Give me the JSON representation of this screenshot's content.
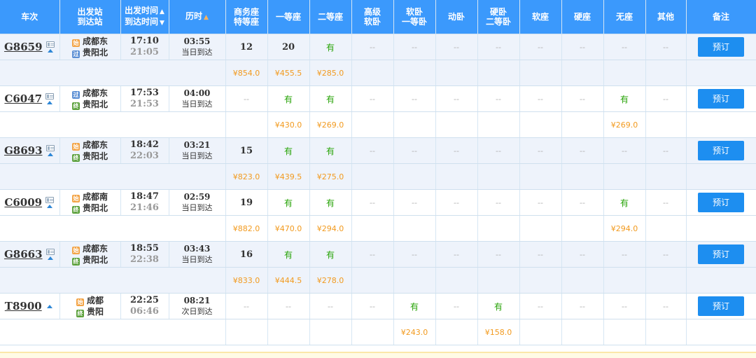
{
  "headers": {
    "train": "车次",
    "station_a": "出发站",
    "station_b": "到达站",
    "time_a": "出发时间",
    "time_b": "到达时间",
    "duration": "历时",
    "business_a": "商务座",
    "business_b": "特等座",
    "first": "一等座",
    "second": "二等座",
    "highsoft_a": "高级",
    "highsoft_b": "软卧",
    "soft_a": "软卧",
    "soft_b": "一等卧",
    "dongwo": "动卧",
    "hard_a": "硬卧",
    "hard_b": "二等卧",
    "softseat": "软座",
    "hardseat": "硬座",
    "noseat": "无座",
    "other": "其他",
    "remark": "备注"
  },
  "icons": {
    "sort_up": "caret-up",
    "sort_down": "caret-down",
    "train_info": "id-card-icon",
    "expand": "triangle-up-icon"
  },
  "colors": {
    "header_bg": "#3b99fc",
    "button_bg": "#1d8ef0",
    "available": "#26a306",
    "price": "#f29a1e"
  },
  "trains": [
    {
      "no": "G8659",
      "from_badge": "始",
      "from": "成都东",
      "to_badge": "过",
      "to": "贵阳北",
      "dep": "17:10",
      "arr": "21:05",
      "dur": "03:55",
      "dur_note": "当日到达",
      "seats": [
        "12",
        "20",
        "有",
        "--",
        "--",
        "--",
        "--",
        "--",
        "--",
        "--",
        "--"
      ],
      "prices": [
        "¥854.0",
        "¥455.5",
        "¥285.0",
        "",
        "",
        "",
        "",
        "",
        "",
        "",
        ""
      ],
      "book": "预订"
    },
    {
      "no": "C6047",
      "from_badge": "过",
      "from": "成都东",
      "to_badge": "终",
      "to": "贵阳北",
      "dep": "17:53",
      "arr": "21:53",
      "dur": "04:00",
      "dur_note": "当日到达",
      "seats": [
        "--",
        "有",
        "有",
        "--",
        "--",
        "--",
        "--",
        "--",
        "--",
        "有",
        "--"
      ],
      "prices": [
        "",
        "¥430.0",
        "¥269.0",
        "",
        "",
        "",
        "",
        "",
        "",
        "¥269.0",
        ""
      ],
      "book": "预订"
    },
    {
      "no": "G8693",
      "from_badge": "始",
      "from": "成都东",
      "to_badge": "终",
      "to": "贵阳北",
      "dep": "18:42",
      "arr": "22:03",
      "dur": "03:21",
      "dur_note": "当日到达",
      "seats": [
        "15",
        "有",
        "有",
        "--",
        "--",
        "--",
        "--",
        "--",
        "--",
        "--",
        "--"
      ],
      "prices": [
        "¥823.0",
        "¥439.5",
        "¥275.0",
        "",
        "",
        "",
        "",
        "",
        "",
        "",
        ""
      ],
      "book": "预订"
    },
    {
      "no": "C6009",
      "from_badge": "始",
      "from": "成都南",
      "to_badge": "终",
      "to": "贵阳北",
      "dep": "18:47",
      "arr": "21:46",
      "dur": "02:59",
      "dur_note": "当日到达",
      "seats": [
        "19",
        "有",
        "有",
        "--",
        "--",
        "--",
        "--",
        "--",
        "--",
        "有",
        "--"
      ],
      "prices": [
        "¥882.0",
        "¥470.0",
        "¥294.0",
        "",
        "",
        "",
        "",
        "",
        "",
        "¥294.0",
        ""
      ],
      "book": "预订"
    },
    {
      "no": "G8663",
      "from_badge": "始",
      "from": "成都东",
      "to_badge": "终",
      "to": "贵阳北",
      "dep": "18:55",
      "arr": "22:38",
      "dur": "03:43",
      "dur_note": "当日到达",
      "seats": [
        "16",
        "有",
        "有",
        "--",
        "--",
        "--",
        "--",
        "--",
        "--",
        "--",
        "--"
      ],
      "prices": [
        "¥833.0",
        "¥444.5",
        "¥278.0",
        "",
        "",
        "",
        "",
        "",
        "",
        "",
        ""
      ],
      "book": "预订"
    },
    {
      "no": "T8900",
      "from_badge": "始",
      "from": "成都",
      "to_badge": "终",
      "to": "贵阳",
      "dep": "22:25",
      "arr": "06:46",
      "dur": "08:21",
      "dur_note": "次日到达",
      "seats": [
        "--",
        "--",
        "--",
        "--",
        "有",
        "--",
        "有",
        "--",
        "--",
        "--",
        "--"
      ],
      "prices": [
        "",
        "",
        "",
        "",
        "¥243.0",
        "",
        "¥158.0",
        "",
        "",
        "",
        ""
      ],
      "book": "预订"
    }
  ]
}
